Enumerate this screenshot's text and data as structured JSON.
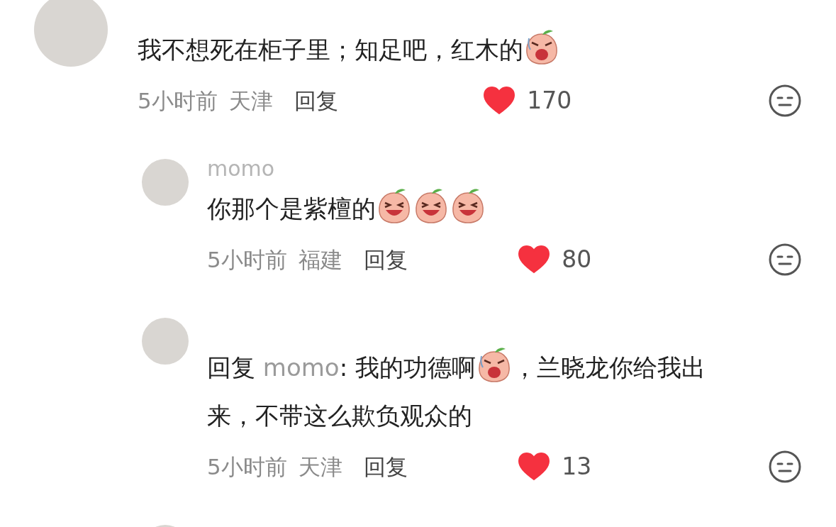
{
  "comments": [
    {
      "content": [
        {
          "kind": "text",
          "text": "我不想死在柜子里；知足吧，红木的"
        },
        {
          "kind": "wince"
        }
      ],
      "time": "5小时前",
      "location": "天津",
      "reply_label": "回复",
      "likes": "170",
      "liked": true,
      "replies": [
        {
          "kind": "full",
          "username": "momo",
          "content": [
            {
              "kind": "text",
              "text": "你那个是紫檀的"
            },
            {
              "kind": "laugh"
            },
            {
              "kind": "laugh"
            },
            {
              "kind": "laugh"
            }
          ],
          "time": "5小时前",
          "location": "福建",
          "reply_label": "回复",
          "likes": "80",
          "liked": true
        },
        {
          "kind": "full",
          "content": [
            {
              "kind": "text",
              "text": "回复 "
            },
            {
              "kind": "mention",
              "text": "momo"
            },
            {
              "kind": "text",
              "text": ": 我的功德啊"
            },
            {
              "kind": "wince"
            },
            {
              "kind": "text",
              "text": "，兰晓龙你给我出"
            },
            {
              "kind": "text",
              "text": "来，不带这么欺负观众的"
            }
          ],
          "time": "5小时前",
          "location": "天津",
          "reply_label": "回复",
          "likes": "13",
          "liked": true
        },
        {
          "kind": "cut"
        }
      ]
    }
  ]
}
